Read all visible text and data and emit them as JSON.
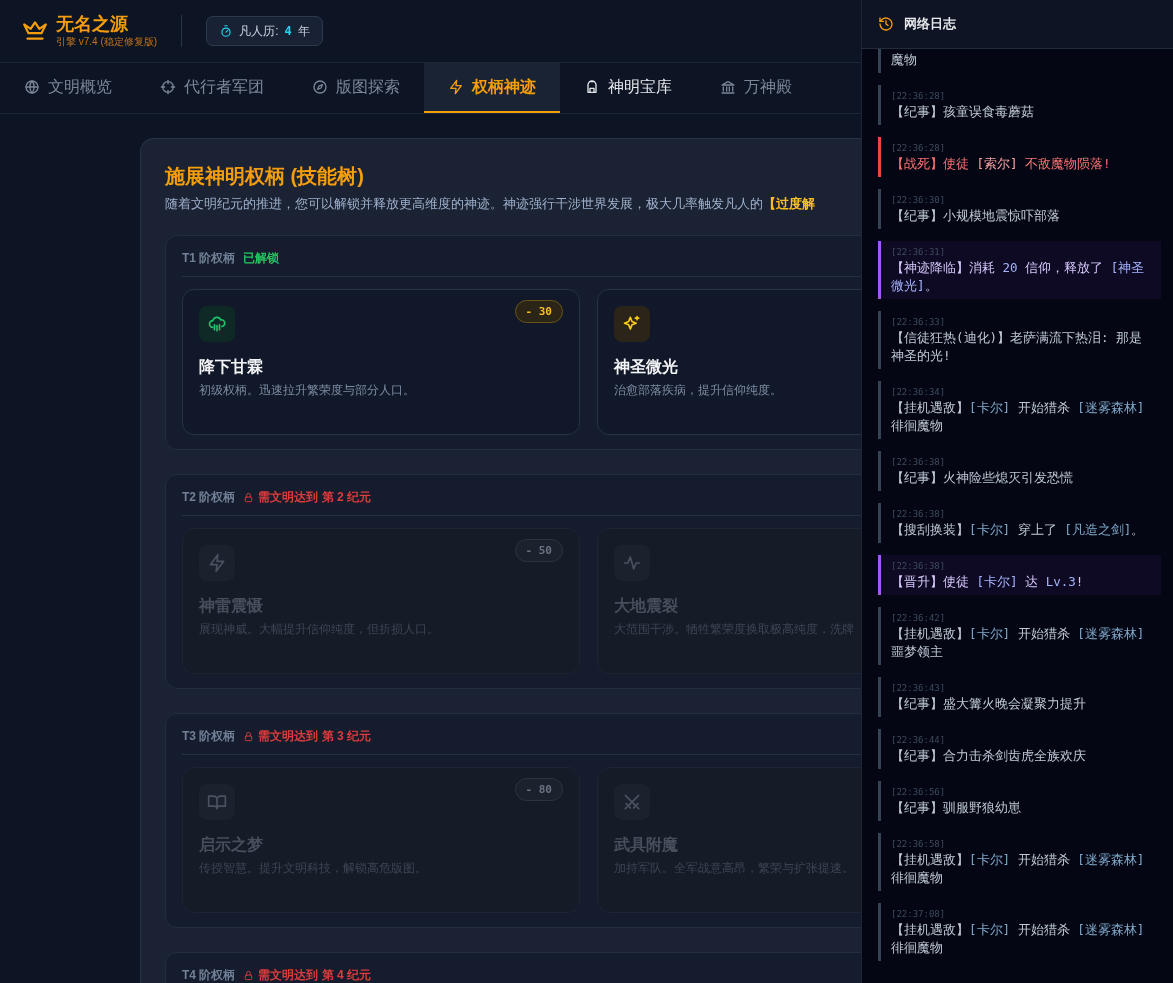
{
  "app": {
    "title": "无名之源",
    "subtitle": "引擎 v7.4 (稳定修复版)",
    "era_label": "凡人历:",
    "era_value": "4",
    "era_unit": "年"
  },
  "tabs": [
    {
      "label": "文明概览",
      "selected": false,
      "highlighted": false
    },
    {
      "label": "代行者军团",
      "selected": false,
      "highlighted": false
    },
    {
      "label": "版图探索",
      "selected": false,
      "highlighted": false
    },
    {
      "label": "权柄神迹",
      "selected": true,
      "highlighted": false
    },
    {
      "label": "神明宝库",
      "selected": false,
      "highlighted": true
    },
    {
      "label": "万神殿",
      "selected": false,
      "highlighted": false
    }
  ],
  "skills": {
    "title": "施展神明权柄 (技能树)",
    "intro": "随着文明纪元的推进，您可以解锁并释放更高维度的神迹。神迹强行干涉世界发展，极大几率触发凡人的",
    "intro_emphasis": "【过度解",
    "tiers": [
      {
        "label": "T1 阶权柄",
        "status": "已解锁",
        "locked": false,
        "cards": [
          {
            "name": "降下甘霖",
            "desc": "初级权柄。迅速拉升繁荣度与部分人口。",
            "cost": "- 30"
          },
          {
            "name": "神圣微光",
            "desc": "治愈部落疾病，提升信仰纯度。"
          }
        ]
      },
      {
        "label": "T2 阶权柄",
        "status": "需文明达到 第 2 纪元",
        "locked": true,
        "cards": [
          {
            "name": "神雷震慑",
            "desc": "展现神威。大幅提升信仰纯度，但折损人口。",
            "cost": "- 50"
          },
          {
            "name": "大地震裂",
            "desc": "大范围干涉。牺牲繁荣度换取极高纯度，洗牌"
          }
        ]
      },
      {
        "label": "T3 阶权柄",
        "status": "需文明达到 第 3 纪元",
        "locked": true,
        "cards": [
          {
            "name": "启示之梦",
            "desc": "传授智慧。提升文明科技，解锁高危版图。",
            "cost": "- 80"
          },
          {
            "name": "武具附魔",
            "desc": "加持军队。全军战意高昂，繁荣与扩张提速。"
          }
        ]
      },
      {
        "label": "T4 阶权柄",
        "status": "需文明达到 第 4 纪元",
        "locked": true
      }
    ]
  },
  "log": {
    "title": "网络日志",
    "entries": [
      {
        "kind": "normal",
        "parts": [
          {
            "text": "魔物",
            "highlight": false
          }
        ]
      },
      {
        "kind": "normal",
        "time": "[22:36:28]",
        "parts": [
          {
            "text": "【纪事】孩童误食毒蘑菇",
            "highlight": false
          }
        ]
      },
      {
        "kind": "death",
        "time": "[22:36:28]",
        "parts": [
          {
            "text": "【战死】使徒 ",
            "highlight": false
          },
          {
            "text": "[索尔]",
            "highlight": true
          },
          {
            "text": " 不敌魔物陨落!",
            "highlight": false
          }
        ]
      },
      {
        "kind": "normal",
        "time": "[22:36:30]",
        "parts": [
          {
            "text": "【纪事】小规模地震惊吓部落",
            "highlight": false
          }
        ]
      },
      {
        "kind": "miracle",
        "time": "[22:36:31]",
        "parts": [
          {
            "text": "【神迹降临】消耗 ",
            "highlight": false
          },
          {
            "text": "20",
            "highlight": true
          },
          {
            "text": " 信仰，释放了 ",
            "highlight": false
          },
          {
            "text": "[神圣微光]",
            "highlight": true
          },
          {
            "text": "。",
            "highlight": false
          }
        ]
      },
      {
        "kind": "normal",
        "time": "[22:36:33]",
        "parts": [
          {
            "text": "【信徒狂热(迪化)】老萨满流下热泪: 那是神圣的光!",
            "highlight": false
          }
        ]
      },
      {
        "kind": "normal",
        "time": "[22:36:34]",
        "parts": [
          {
            "text": "【挂机遇敌】",
            "highlight": false
          },
          {
            "text": "[卡尔]",
            "highlight": true
          },
          {
            "text": " 开始猎杀 ",
            "highlight": false
          },
          {
            "text": "[迷雾森林]",
            "highlight": true
          },
          {
            "text": " 徘徊魔物",
            "highlight": false
          }
        ]
      },
      {
        "kind": "normal",
        "time": "[22:36:38]",
        "parts": [
          {
            "text": "【纪事】火神险些熄灭引发恐慌",
            "highlight": false
          }
        ]
      },
      {
        "kind": "normal",
        "time": "[22:36:38]",
        "parts": [
          {
            "text": "【搜刮换装】",
            "highlight": false
          },
          {
            "text": "[卡尔]",
            "highlight": true
          },
          {
            "text": " 穿上了 ",
            "highlight": false
          },
          {
            "text": "[凡造之剑]",
            "highlight": true
          },
          {
            "text": "。",
            "highlight": false
          }
        ]
      },
      {
        "kind": "miracle",
        "time": "[22:36:38]",
        "parts": [
          {
            "text": "【晋升】使徒 ",
            "highlight": false
          },
          {
            "text": "[卡尔]",
            "highlight": true
          },
          {
            "text": " 达 ",
            "highlight": false
          },
          {
            "text": "Lv.3",
            "highlight": true
          },
          {
            "text": "!",
            "highlight": false
          }
        ]
      },
      {
        "kind": "normal",
        "time": "[22:36:42]",
        "parts": [
          {
            "text": "【挂机遇敌】",
            "highlight": false
          },
          {
            "text": "[卡尔]",
            "highlight": true
          },
          {
            "text": " 开始猎杀 ",
            "highlight": false
          },
          {
            "text": "[迷雾森林]",
            "highlight": true
          },
          {
            "text": " 噩梦领主",
            "highlight": false
          }
        ]
      },
      {
        "kind": "normal",
        "time": "[22:36:43]",
        "parts": [
          {
            "text": "【纪事】盛大篝火晚会凝聚力提升",
            "highlight": false
          }
        ]
      },
      {
        "kind": "normal",
        "time": "[22:36:44]",
        "parts": [
          {
            "text": "【纪事】合力击杀剑齿虎全族欢庆",
            "highlight": false
          }
        ]
      },
      {
        "kind": "normal",
        "time": "[22:36:56]",
        "parts": [
          {
            "text": "【纪事】驯服野狼幼崽",
            "highlight": false
          }
        ]
      },
      {
        "kind": "normal",
        "time": "[22:36:58]",
        "parts": [
          {
            "text": "【挂机遇敌】",
            "highlight": false
          },
          {
            "text": "[卡尔]",
            "highlight": true
          },
          {
            "text": " 开始猎杀 ",
            "highlight": false
          },
          {
            "text": "[迷雾森林]",
            "highlight": true
          },
          {
            "text": " 徘徊魔物",
            "highlight": false
          }
        ]
      },
      {
        "kind": "normal",
        "time": "[22:37:08]",
        "parts": [
          {
            "text": "【挂机遇敌】",
            "highlight": false
          },
          {
            "text": "[卡尔]",
            "highlight": true
          },
          {
            "text": " 开始猎杀 ",
            "highlight": false
          },
          {
            "text": "[迷雾森林]",
            "highlight": true
          },
          {
            "text": " 徘徊魔物",
            "highlight": false
          }
        ]
      }
    ]
  }
}
